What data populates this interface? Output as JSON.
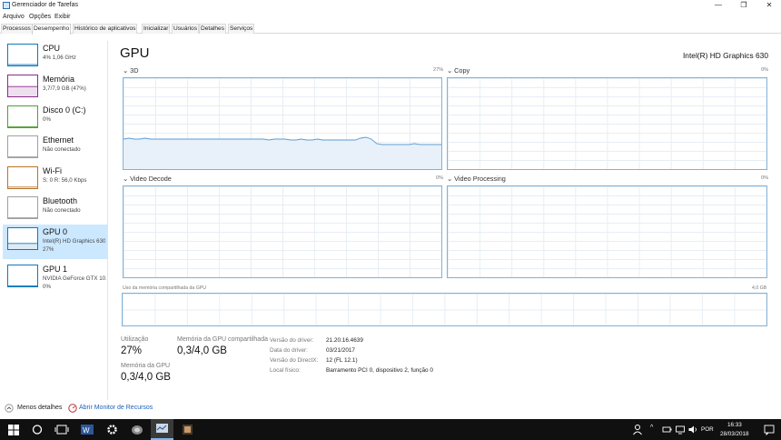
{
  "window": {
    "title": "Gerenciador de Tarefas",
    "minimize_glyph": "—",
    "maximize_glyph": "❐",
    "close_glyph": "✕"
  },
  "menu": [
    "Arquivo",
    "Opções",
    "Exibir"
  ],
  "tabs": [
    "Processos",
    "Desempenho",
    "Histórico de aplicativos",
    "Inicializar",
    "Usuários",
    "Detalhes",
    "Serviços"
  ],
  "sidebar": [
    {
      "name": "CPU",
      "sub": [
        "4% 1,06 GHz"
      ],
      "color": "#1177bb",
      "level": 0.04
    },
    {
      "name": "Memória",
      "sub": [
        "3,7/7,9 GB (47%)"
      ],
      "color": "#8b2a8b",
      "level": 0.47
    },
    {
      "name": "Disco 0 (C:)",
      "sub": [
        "0%"
      ],
      "color": "#4da033",
      "level": 0.0
    },
    {
      "name": "Ethernet",
      "sub": [
        "Não conectado"
      ],
      "color": "#a0a0a0",
      "level": 0.0
    },
    {
      "name": "Wi-Fi",
      "sub": [
        "S: 0 R: 56,0 Kbps"
      ],
      "color": "#b8742a",
      "level": 0.05
    },
    {
      "name": "Bluetooth",
      "sub": [
        "Não conectado"
      ],
      "color": "#a0a0a0",
      "level": 0.0
    },
    {
      "name": "GPU 0",
      "sub": [
        "Intel(R) HD Graphics 630",
        "27%"
      ],
      "color": "#1177bb",
      "level": 0.27
    },
    {
      "name": "GPU 1",
      "sub": [
        "NVIDIA GeForce GTX 10...",
        "0%"
      ],
      "color": "#1177bb",
      "level": 0.0
    }
  ],
  "main": {
    "title": "GPU",
    "adapter": "Intel(R) HD Graphics 630",
    "graphs": [
      {
        "label": "3D",
        "pct": "27%"
      },
      {
        "label": "Copy",
        "pct": "0%"
      },
      {
        "label": "Video Decode",
        "pct": "0%"
      },
      {
        "label": "Video Processing",
        "pct": "0%"
      }
    ],
    "memory_graph": {
      "label": "Uso da memória compartilhada da GPU",
      "max": "4,0 GB"
    },
    "stats": {
      "utilization_label": "Utilização",
      "utilization_value": "27%",
      "shared_label": "Memória da GPU compartilhada",
      "shared_value": "0,3/4,0 GB",
      "gpu_mem_label": "Memória da GPU",
      "gpu_mem_value": "0,3/4,0 GB"
    },
    "info": [
      {
        "label": "Versão do driver:",
        "value": "21.20.16.4639"
      },
      {
        "label": "Data do driver:",
        "value": "03/21/2017"
      },
      {
        "label": "Versão do DirectX:",
        "value": "12 (FL 12.1)"
      },
      {
        "label": "Local físico:",
        "value": "Barramento PCI 0, dispositivo 2, função 0"
      }
    ]
  },
  "footer": {
    "fewer_details": "Menos detalhes",
    "resource_monitor": "Abrir Monitor de Recursos"
  },
  "taskbar": {
    "language": "POR",
    "time": "16:33",
    "date": "28/03/2018"
  },
  "chart_data": {
    "type": "area",
    "x": [
      0,
      1,
      2,
      3,
      4,
      5,
      6,
      7,
      8,
      9,
      10,
      11,
      12,
      13,
      14,
      15,
      16,
      17,
      18,
      19,
      20,
      21,
      22,
      23,
      24,
      25,
      26,
      27,
      28,
      29,
      30,
      31,
      32,
      33,
      34,
      35,
      36,
      37,
      38,
      39,
      40,
      41,
      42,
      43,
      44,
      45,
      46,
      47,
      48,
      49,
      50,
      51,
      52,
      53,
      54,
      55,
      56,
      57,
      58,
      59
    ],
    "values": [
      33,
      34,
      33,
      33,
      34,
      33,
      33,
      33,
      33,
      33,
      33,
      33,
      33,
      33,
      33,
      33,
      33,
      33,
      33,
      33,
      33,
      33,
      33,
      33,
      33,
      33,
      33,
      32,
      33,
      33,
      33,
      32,
      32,
      33,
      32,
      32,
      33,
      32,
      32,
      32,
      32,
      32,
      32,
      32,
      34,
      35,
      33,
      28,
      27,
      27,
      27,
      27,
      27,
      27,
      28,
      27,
      27,
      27,
      27,
      27
    ],
    "ylim": [
      0,
      100
    ]
  }
}
